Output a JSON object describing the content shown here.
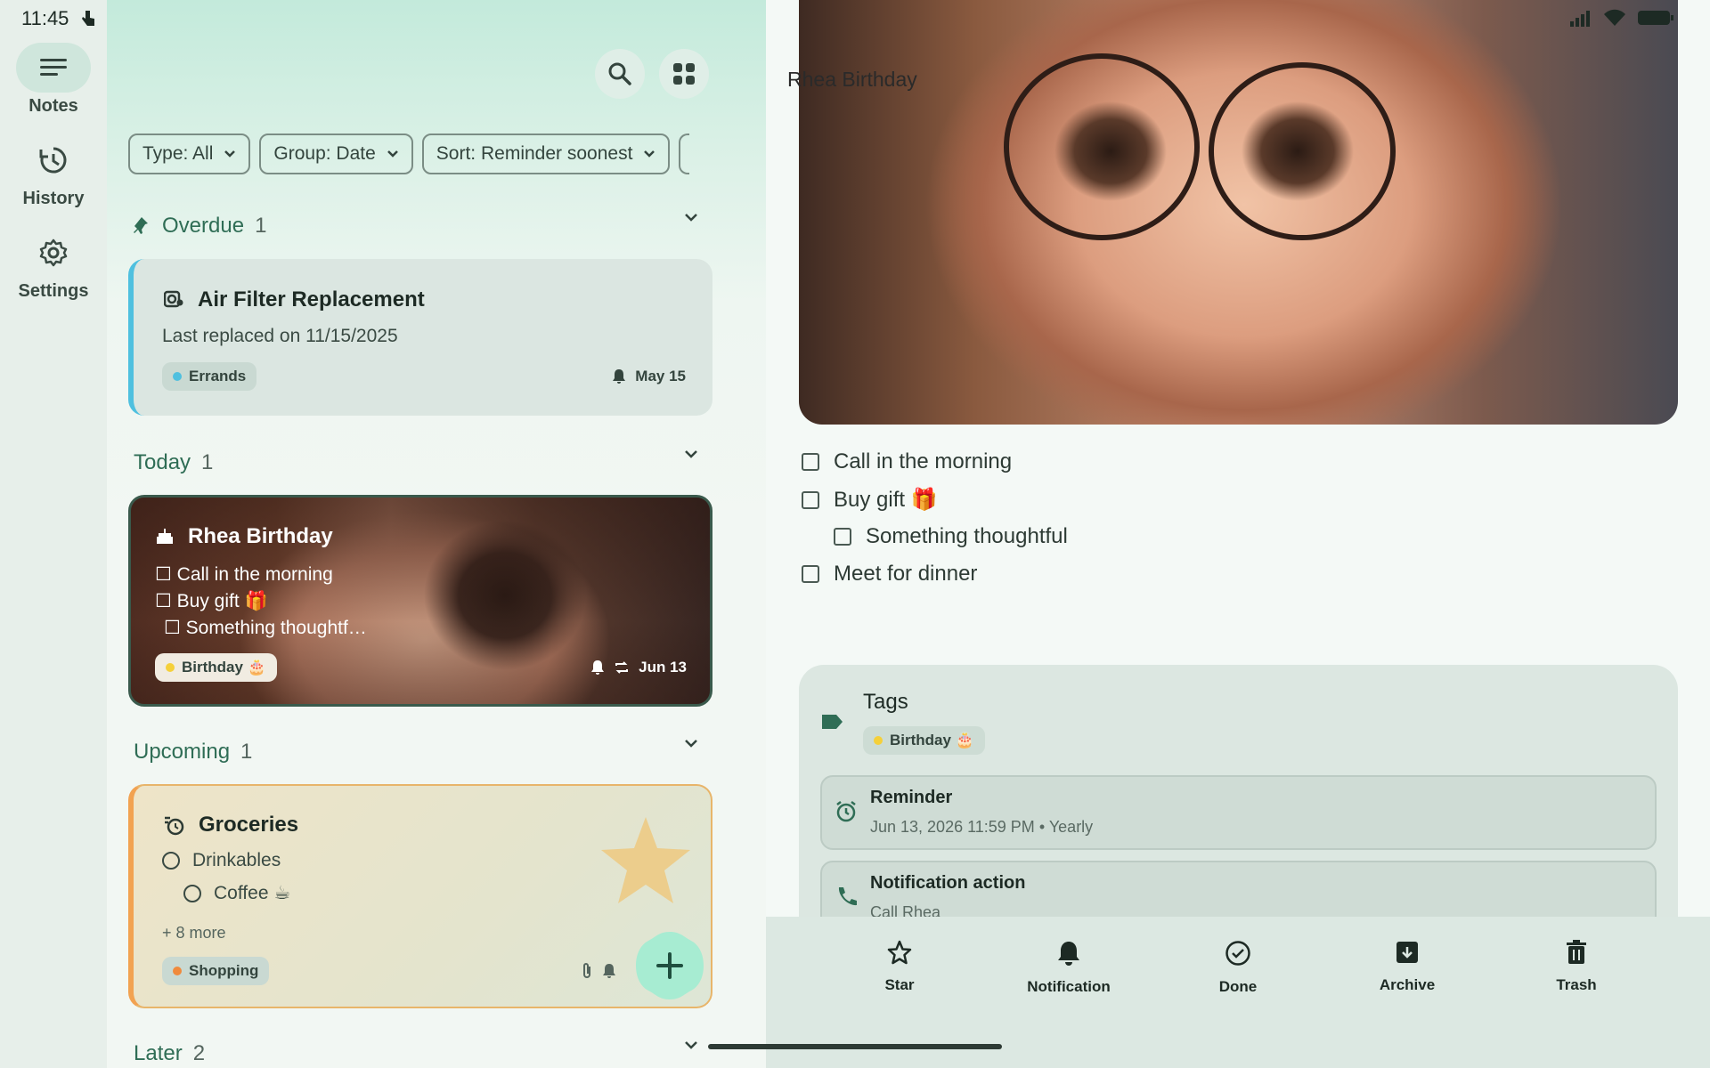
{
  "status_bar": {
    "time": "11:45"
  },
  "nav_rail": {
    "items": [
      {
        "label": "Notes",
        "icon": "notes-icon",
        "active": true
      },
      {
        "label": "History",
        "icon": "history-icon",
        "active": false
      },
      {
        "label": "Settings",
        "icon": "gear-icon",
        "active": false
      }
    ]
  },
  "filters": {
    "type": "Type: All",
    "group": "Group: Date",
    "sort": "Sort: Reminder soonest"
  },
  "sections": {
    "overdue": {
      "label": "Overdue",
      "count": "1"
    },
    "today": {
      "label": "Today",
      "count": "1"
    },
    "upcoming": {
      "label": "Upcoming",
      "count": "1"
    },
    "later": {
      "label": "Later",
      "count": "2"
    }
  },
  "cards": {
    "air": {
      "title": "Air Filter Replacement",
      "body": "Last replaced on 11/15/2025",
      "tag": "Errands",
      "tag_color": "#4fc0df",
      "date": "May 15"
    },
    "rhea": {
      "title": "Rhea Birthday",
      "items": [
        "☐ Call in the morning",
        "☐ Buy gift 🎁",
        "☐ Something thoughtf…"
      ],
      "tag": "Birthday 🎂",
      "tag_color": "#f5d03a",
      "date": "Jun 13"
    },
    "groceries": {
      "title": "Groceries",
      "items": [
        "Drinkables",
        "Coffee ☕"
      ],
      "more": "+ 8 more",
      "tag": "Shopping",
      "tag_color": "#f08a3c"
    }
  },
  "detail": {
    "title": "Rhea Birthday",
    "checklist": [
      {
        "text": "Call in the morning",
        "indent": false
      },
      {
        "text": "Buy gift 🎁",
        "indent": false
      },
      {
        "text": "Something thoughtful",
        "indent": true
      },
      {
        "text": "Meet for dinner",
        "indent": false
      }
    ],
    "tags_label": "Tags",
    "tag": "Birthday 🎂",
    "reminder": {
      "label": "Reminder",
      "value": "Jun 13, 2026 11:59 PM",
      "repeat": "Yearly"
    },
    "notification": {
      "label": "Notification action",
      "value": "Call Rhea"
    }
  },
  "actions": [
    {
      "label": "Star",
      "icon": "star-icon"
    },
    {
      "label": "Notification",
      "icon": "bell-icon"
    },
    {
      "label": "Done",
      "icon": "check-circle-icon"
    },
    {
      "label": "Archive",
      "icon": "archive-icon"
    },
    {
      "label": "Trash",
      "icon": "trash-icon"
    }
  ]
}
